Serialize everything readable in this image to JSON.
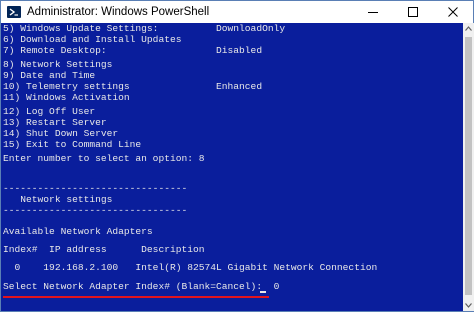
{
  "window": {
    "title": "Administrator: Windows PowerShell",
    "app_icon": "powershell-icon",
    "controls": [
      "minimize-icon",
      "maximize-icon",
      "close-icon"
    ]
  },
  "console": {
    "background": "#0a1e9c",
    "text_color": "#e8e8e8",
    "highlight_color": "#e0141e",
    "lines": [
      "5) Windows Update Settings:          DownloadOnly",
      "6) Download and Install Updates",
      "7) Remote Desktop:                   Disabled",
      "",
      "8) Network Settings",
      "9) Date and Time",
      "10) Telemetry settings               Enhanced",
      "11) Windows Activation",
      "",
      "12) Log Off User",
      "13) Restart Server",
      "14) Shut Down Server",
      "15) Exit to Command Line",
      "",
      "Enter number to select an option: 8",
      "",
      "",
      "--------------------------------",
      "   Network settings",
      "--------------------------------",
      "",
      "Available Network Adapters",
      "",
      "Index#  IP address      Description",
      "",
      "  0    192.168.2.100   Intel(R) 82574L Gigabit Network Connection",
      "",
      "Select Network Adapter Index# (Blank=Cancel):  0"
    ]
  }
}
